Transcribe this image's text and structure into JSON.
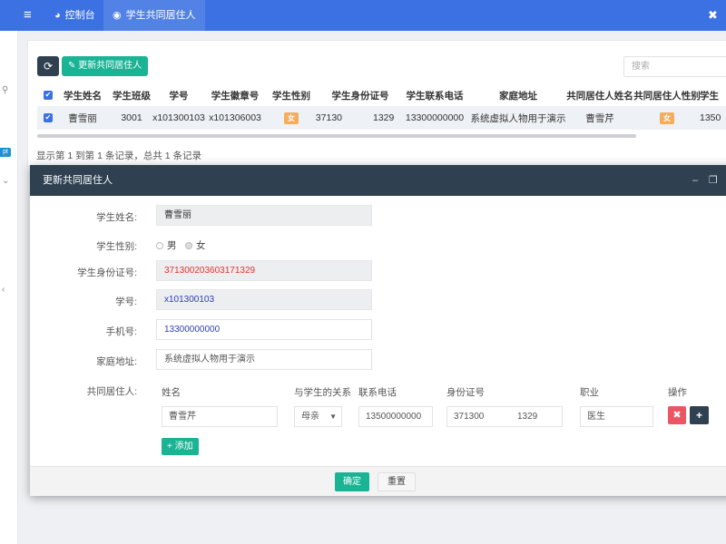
{
  "topbar": {
    "menu_icon": "menu-icon",
    "tabs": [
      {
        "label": "控制台",
        "icon": "dashboard-icon"
      },
      {
        "label": "学生共同居住人",
        "icon": "circle-icon"
      }
    ]
  },
  "sidebar": {
    "badge": "pt"
  },
  "toolbar": {
    "update_label": "更新共同居住人",
    "search_placeholder": "搜索"
  },
  "table": {
    "columns": [
      "学生姓名",
      "学生班级",
      "学号",
      "学生徽章号",
      "学生性别",
      "学生身份证号",
      "学生联系电话",
      "家庭地址",
      "共同居住人姓名",
      "共同居住人性别",
      "学生"
    ],
    "rows": [
      [
        "曹雪丽",
        "3001",
        "x101300103",
        "x101306003",
        "女",
        "37130",
        "1329",
        "13300000000",
        "系统虚拟人物用于演示",
        "曹雪芹",
        "女",
        "1350"
      ]
    ]
  },
  "pagination": {
    "info": "显示第 1 到第 1 条记录，总共 1 条记录"
  },
  "modal": {
    "title": "更新共同居住人",
    "fields": {
      "name_label": "学生姓名:",
      "name_value": "曹雪丽",
      "gender_label": "学生性别:",
      "gender_male": "男",
      "gender_female": "女",
      "idcard_label": "学生身份证号:",
      "idcard_value": "371300203603171329",
      "studentno_label": "学号:",
      "studentno_value": "x101300103",
      "phone_label": "手机号:",
      "phone_value": "13300000000",
      "address_label": "家庭地址:",
      "address_value": "系统虚拟人物用于演示",
      "cohabitant_label": "共同居住人:"
    },
    "cohab_headers": [
      "姓名",
      "与学生的关系",
      "联系电话",
      "身份证号",
      "职业",
      "操作"
    ],
    "cohab_row": {
      "name": "曹雪芹",
      "relation": "母亲",
      "phone": "13500000000",
      "idcard_a": "371300",
      "idcard_b": "1329",
      "job": "医生"
    },
    "add_label": "添加",
    "ok_label": "确定",
    "reset_label": "重置"
  },
  "colors": {
    "topbar": "#3c71e3",
    "primary": "#1ab394",
    "dark": "#2f4050",
    "danger": "#ed5565",
    "badge": "#f8ac59",
    "red_text": "#e0352b",
    "blue_text": "#2c3fb8"
  }
}
